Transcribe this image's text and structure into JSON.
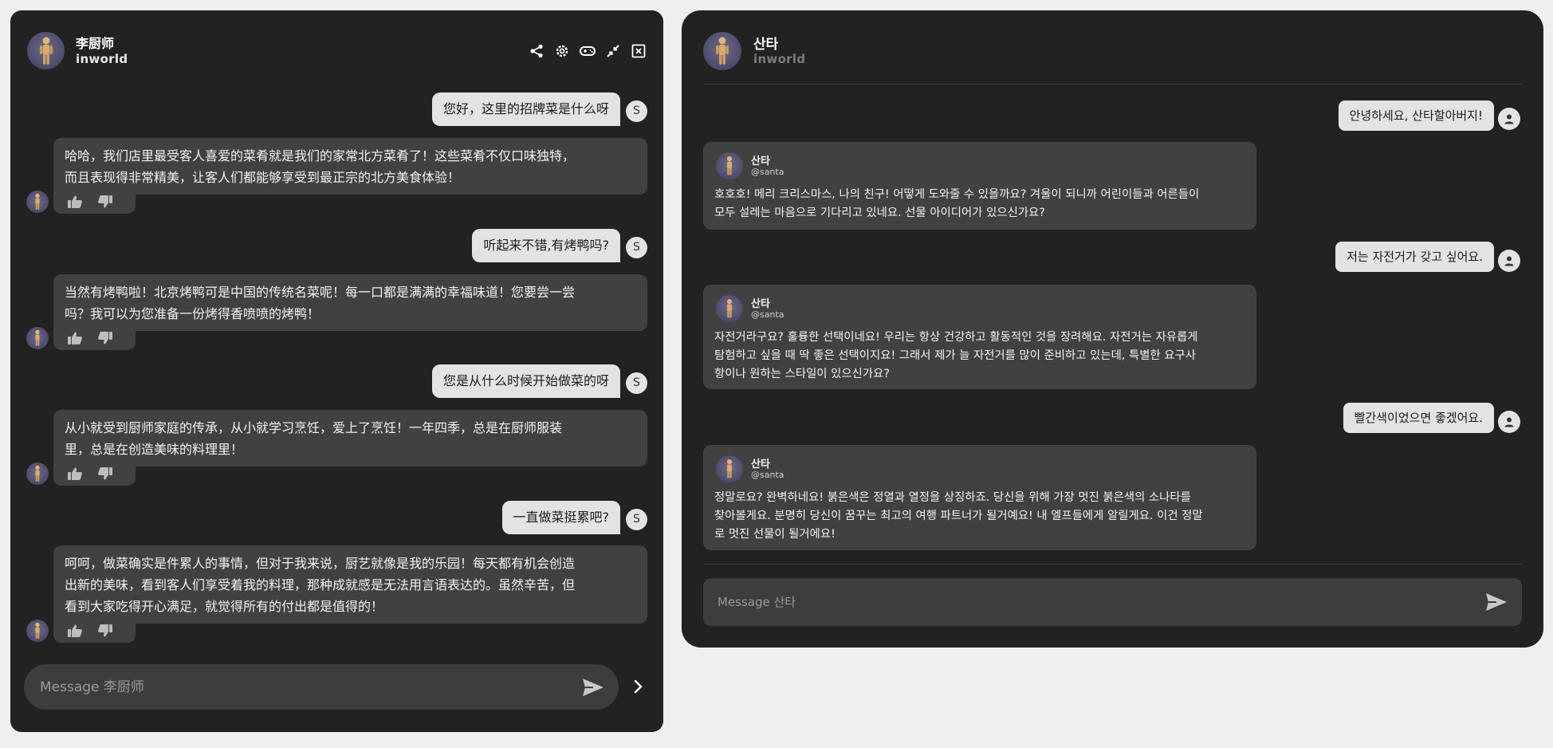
{
  "left": {
    "character_name": "李厨师",
    "brand": "inworld",
    "input_placeholder": "Message 李厨师",
    "messages": [
      {
        "role": "user",
        "text": "您好，这里的招牌菜是什么呀",
        "initial": "S"
      },
      {
        "role": "bot",
        "lines": [
          "哈哈，我们店里最受客人喜爱的菜肴就是我们的家常北方菜肴了！这些菜肴不仅口味独特，",
          "而且表现得非常精美，让客人们都能够享受到最正宗的北方美食体验！"
        ]
      },
      {
        "role": "user",
        "text": "听起来不错,有烤鸭吗?",
        "initial": "S"
      },
      {
        "role": "bot",
        "lines": [
          "当然有烤鸭啦！北京烤鸭可是中国的传统名菜呢！每一口都是满满的幸福味道！您要尝一尝",
          "吗？我可以为您准备一份烤得香喷喷的烤鸭！"
        ]
      },
      {
        "role": "user",
        "text": "您是从什么时候开始做菜的呀",
        "initial": "S"
      },
      {
        "role": "bot",
        "lines": [
          "从小就受到厨师家庭的传承，从小就学习烹饪，爱上了烹饪！一年四季，总是在厨师服装",
          "里，总是在创造美味的料理里！"
        ]
      },
      {
        "role": "user",
        "text": "一直做菜挺累吧?",
        "initial": "S"
      },
      {
        "role": "bot",
        "lines": [
          "呵呵，做菜确实是件累人的事情，但对于我来说，厨艺就像是我的乐园！每天都有机会创造",
          "出新的美味，看到客人们享受着我的料理，那种成就感是无法用言语表达的。虽然辛苦，但",
          "看到大家吃得开心满足，就觉得所有的付出都是值得的！"
        ]
      }
    ]
  },
  "right": {
    "character_name": "산타",
    "brand": "inworld",
    "input_placeholder": "Message 산타",
    "messages": [
      {
        "role": "user",
        "text": "안녕하세요, 산타할아버지!"
      },
      {
        "role": "bot",
        "name": "산타",
        "handle": "@santa",
        "lines": [
          "호호호! 메리 크리스마스, 나의 친구! 어떻게 도와줄 수 있을까요? 겨울이 되니까 어린이들과 어른들이",
          "모두 설레는 마음으로 기다리고 있네요. 선물 아이디어가 있으신가요?"
        ]
      },
      {
        "role": "user",
        "text": "저는 자전거가 갖고 싶어요."
      },
      {
        "role": "bot",
        "name": "산타",
        "handle": "@santa",
        "lines": [
          "자전거라구요? 훌륭한 선택이네요! 우리는 항상 건강하고 활동적인 것을 장려해요. 자전거는 자유롭게",
          "탐험하고 싶을 때 딱 좋은 선택이지요! 그래서 제가 늘 자전거를 많이 준비하고 있는데, 특별한 요구사",
          "항이나 원하는 스타일이 있으신가요?"
        ]
      },
      {
        "role": "user",
        "text": "빨간색이었으면 좋겠어요."
      },
      {
        "role": "bot",
        "name": "산타",
        "handle": "@santa",
        "lines": [
          "정말로요? 완벽하네요! 붉은색은 정열과 열정을 상징하죠. 당신을 위해 가장 멋진 붉은색의 소나타를",
          "찾아볼게요. 분명히 당신이 꿈꾸는 최고의 여행 파트너가 될거예요! 내 엘프들에게 알릴게요. 이건 정말",
          "로 멋진 선물이 될거에요!"
        ]
      }
    ]
  }
}
